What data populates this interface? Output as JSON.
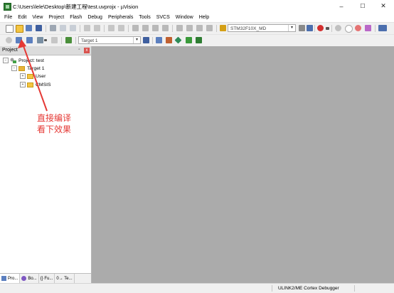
{
  "window": {
    "title": "C:\\Users\\lele\\Desktop\\新建工程\\test.uvprojx - µVision",
    "min_glyph": "–",
    "max_glyph": "☐",
    "close_glyph": "✕"
  },
  "menu": [
    "File",
    "Edit",
    "View",
    "Project",
    "Flash",
    "Debug",
    "Peripherals",
    "Tools",
    "SVCS",
    "Window",
    "Help"
  ],
  "toolbar1": {
    "device_combo": "STM32F10X_MD"
  },
  "toolbar2": {
    "target_combo": "Target 1"
  },
  "project_pane": {
    "title": "Project",
    "pin_glyph": "▫",
    "close_glyph": "x",
    "tree": {
      "root": "Project: test",
      "target": "Target 1",
      "groups": [
        "User",
        "CMSIS"
      ]
    },
    "tabs": [
      "Pro...",
      "Bo...",
      "{} Fu...",
      "0→ Te..."
    ]
  },
  "status": {
    "debugger": "ULINK2/ME Cortex Debugger"
  },
  "annotation": {
    "line1": "直接编译",
    "line2": "看下效果"
  },
  "colors": {
    "accent_red": "#e53935",
    "editor_bg": "#ababab"
  }
}
